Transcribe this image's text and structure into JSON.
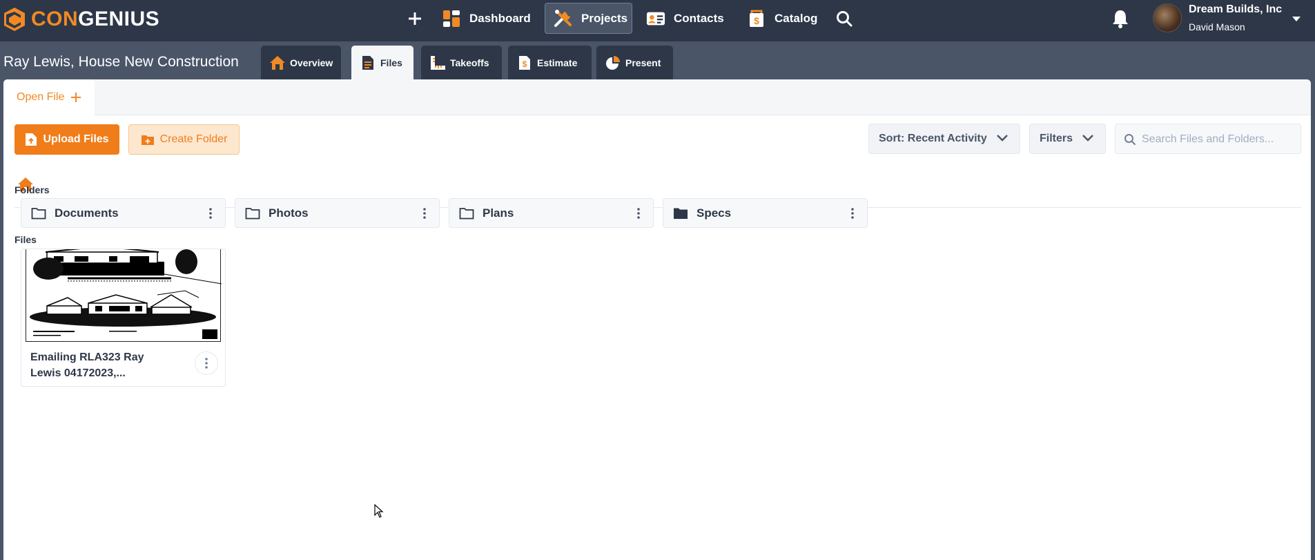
{
  "brand": {
    "part1": "CON",
    "part2": "GENIUS",
    "accent_color": "#f08a24"
  },
  "nav": {
    "add_icon": "plus-icon",
    "items": [
      {
        "label": "Dashboard",
        "icon": "dashboard-icon"
      },
      {
        "label": "Projects",
        "icon": "tools-icon",
        "active": true
      },
      {
        "label": "Contacts",
        "icon": "contact-card-icon"
      },
      {
        "label": "Catalog",
        "icon": "catalog-icon"
      }
    ],
    "search_icon": "search-icon"
  },
  "user": {
    "company": "Dream Builds, Inc",
    "name": "David Mason"
  },
  "project": {
    "title": "Ray Lewis, House New Construction",
    "tabs": [
      {
        "label": "Overview",
        "icon": "house-icon"
      },
      {
        "label": "Files",
        "icon": "file-icon",
        "active": true
      },
      {
        "label": "Takeoffs",
        "icon": "ruler-icon"
      },
      {
        "label": "Estimate",
        "icon": "estimate-icon"
      },
      {
        "label": "Present",
        "icon": "pie-chart-icon"
      }
    ]
  },
  "files_view": {
    "open_tab_label": "Open File",
    "upload_label": "Upload Files",
    "create_folder_label": "Create Folder",
    "sort_label": "Sort: Recent Activity",
    "filters_label": "Filters",
    "search_placeholder": "Search Files and Folders...",
    "folders_heading": "Folders",
    "files_heading": "Files",
    "folders": [
      {
        "name": "Documents",
        "filled": false
      },
      {
        "name": "Photos",
        "filled": false
      },
      {
        "name": "Plans",
        "filled": false
      },
      {
        "name": "Specs",
        "filled": true
      }
    ],
    "files": [
      {
        "name_line1": "Emailing RLA323 Ray",
        "name_line2": "Lewis 04172023,..."
      }
    ]
  }
}
